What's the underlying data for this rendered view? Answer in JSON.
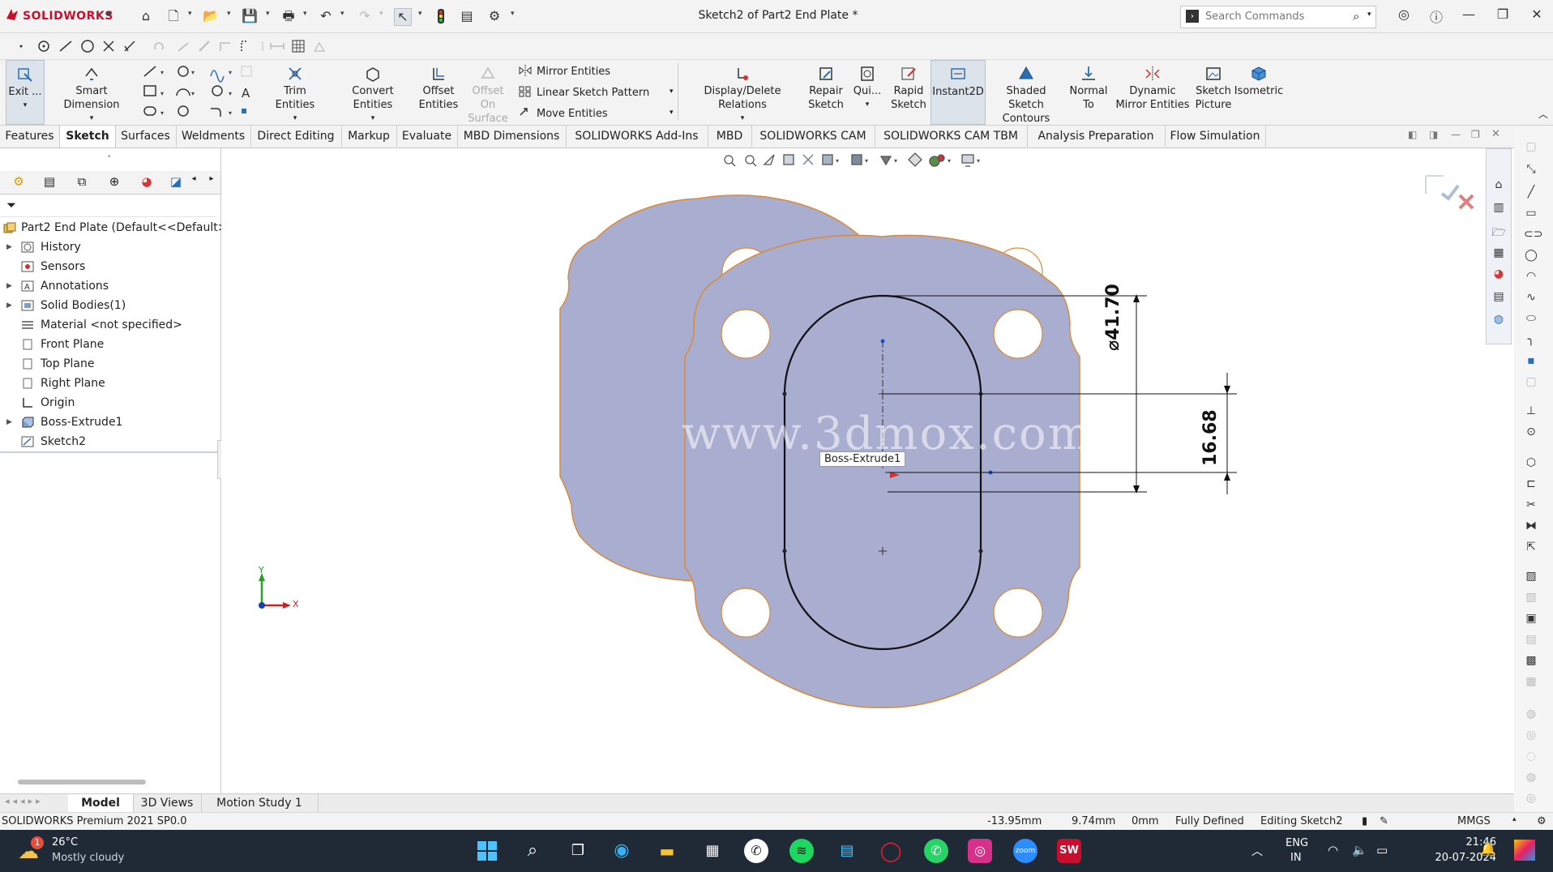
{
  "app": {
    "logo_text": "SOLIDWORKS",
    "doc_title": "Sketch2 of Part2 End Plate *",
    "search_placeholder": "Search Commands"
  },
  "commands": {
    "exit": "Exit ...",
    "smart_dimension": "Smart Dimension",
    "trim": "Trim Entities",
    "convert": "Convert Entities",
    "offset_1": "Offset",
    "offset_2": "Entities",
    "offset_surface_1": "Offset On",
    "offset_surface_2": "Surface",
    "mirror": "Mirror Entities",
    "linear_pattern": "Linear Sketch Pattern",
    "move": "Move Entities",
    "display_delete": "Display/Delete Relations",
    "repair_1": "Repair",
    "repair_2": "Sketch",
    "quick": "Qui...",
    "rapid_1": "Rapid",
    "rapid_2": "Sketch",
    "instant2d": "Instant2D",
    "shaded_1": "Shaded Sketch",
    "shaded_2": "Contours",
    "normal_1": "Normal",
    "normal_2": "To",
    "dynamic_1": "Dynamic",
    "dynamic_2": "Mirror Entities",
    "picture_1": "Sketch",
    "picture_2": "Picture",
    "isometric": "Isometric"
  },
  "tabs": [
    "Features",
    "Sketch",
    "Surfaces",
    "Weldments",
    "Direct Editing",
    "Markup",
    "Evaluate",
    "MBD Dimensions",
    "SOLIDWORKS Add-Ins",
    "MBD",
    "SOLIDWORKS CAM",
    "SOLIDWORKS CAM TBM",
    "Analysis Preparation",
    "Flow Simulation"
  ],
  "tree": {
    "root": "Part2 End Plate  (Default<<Default>_",
    "items": [
      "History",
      "Sensors",
      "Annotations",
      "Solid Bodies(1)",
      "Material <not specified>",
      "Front Plane",
      "Top Plane",
      "Right Plane",
      "Origin",
      "Boss-Extrude1",
      "Sketch2"
    ]
  },
  "graphics": {
    "dim_diameter": "⌀41.70",
    "dim_length": "16.68",
    "tooltip": "Boss-Extrude1",
    "watermark": "www.3dmox.com",
    "axis_x": "X",
    "axis_y": "Y"
  },
  "bottom_tabs": [
    "Model",
    "3D Views",
    "Motion Study 1"
  ],
  "status": {
    "product": "SOLIDWORKS Premium 2021 SP0.0",
    "x": "-13.95mm",
    "y": "9.74mm",
    "z": "0mm",
    "defined": "Fully Defined",
    "editing": "Editing Sketch2",
    "units": "MMGS"
  },
  "taskbar": {
    "temp": "26°C",
    "weather": "Mostly cloudy",
    "badge": "1",
    "lang_1": "ENG",
    "lang_2": "IN",
    "time": "21:46",
    "date": "20-07-2024"
  },
  "colors": {
    "part_fill": "#a9add0",
    "part_edge": "#d98b3a",
    "brand_red": "#c8102e",
    "taskbar_bg": "#1f2a36"
  }
}
